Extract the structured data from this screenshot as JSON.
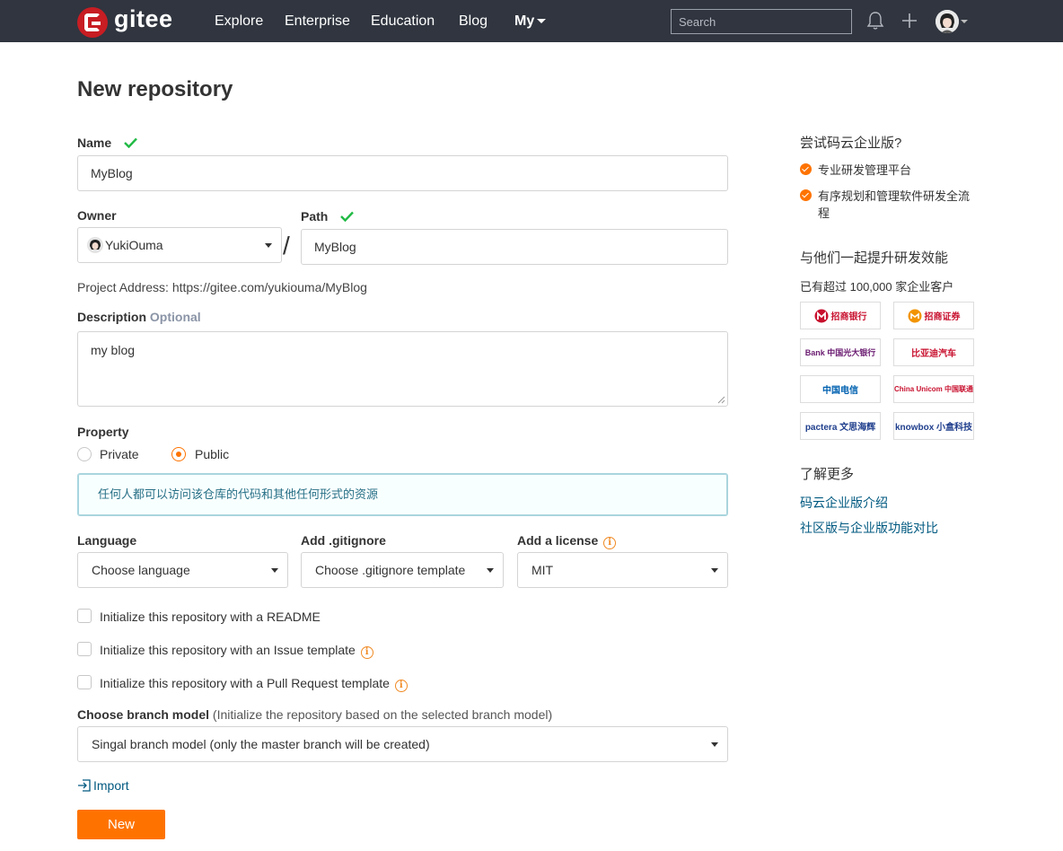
{
  "nav": {
    "brand": "gitee",
    "links": [
      "Explore",
      "Enterprise",
      "Education",
      "Blog"
    ],
    "my": "My",
    "search_placeholder": "Search"
  },
  "form": {
    "title": "New repository",
    "name_label": "Name",
    "name_value": "MyBlog",
    "owner_label": "Owner",
    "owner_value": "YukiOuma",
    "path_label": "Path",
    "path_value": "MyBlog",
    "project_address": "Project Address: https://gitee.com/yukiouma/MyBlog",
    "description_label": "Description",
    "description_optional": "Optional",
    "description_value": "my blog",
    "property_label": "Property",
    "private_label": "Private",
    "public_label": "Public",
    "public_info": "任何人都可以访问该仓库的代码和其他任何形式的资源",
    "language_label": "Language",
    "language_value": "Choose language",
    "gitignore_label": "Add .gitignore",
    "gitignore_value": "Choose .gitignore template",
    "license_label": "Add a license",
    "license_value": "MIT",
    "init_readme": "Initialize this repository with a README",
    "init_issue": "Initialize this repository with an Issue template",
    "init_pr": "Initialize this repository with a Pull Request template",
    "branch_label": "Choose branch model",
    "branch_note": "(Initialize the repository based on the selected branch model)",
    "branch_value": "Singal branch model (only the master branch will be created)",
    "import_label": "Import",
    "submit_label": "New"
  },
  "sidebar": {
    "try_title": "尝试码云企业版?",
    "features": [
      "专业研发管理平台",
      "有序规划和管理软件研发全流程"
    ],
    "together_title": "与他们一起提升研发效能",
    "customers": "已有超过 100,000 家企业客户",
    "logos": [
      "招商银行",
      "招商证券",
      "Bank 中国光大银行",
      "比亚迪汽车",
      "中国电信",
      "China Unicom 中国联通",
      "pactera 文思海辉",
      "knowbox 小盒科技"
    ],
    "more_title": "了解更多",
    "links": [
      "码云企业版介绍",
      "社区版与企业版功能对比"
    ]
  },
  "colors": {
    "topbar": "#30353f",
    "accent": "#fe7300",
    "link": "#005980",
    "success": "#21ba45"
  }
}
